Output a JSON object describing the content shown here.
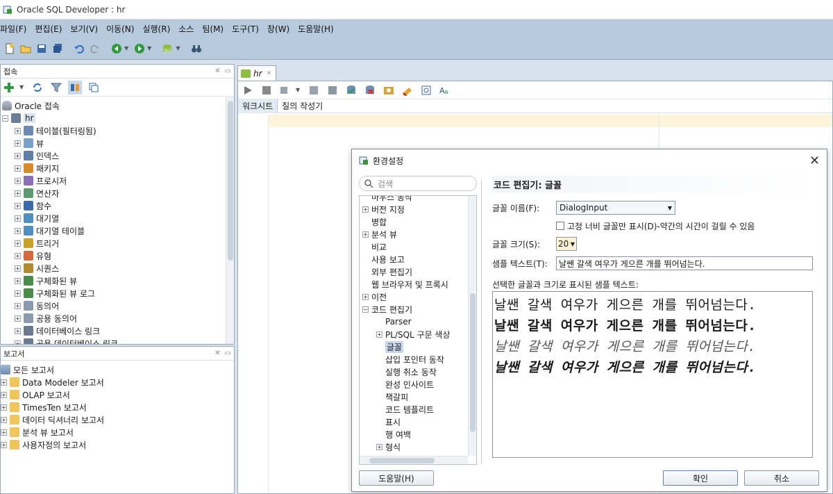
{
  "window": {
    "title": "Oracle SQL Developer : hr"
  },
  "menubar": [
    "파일(F)",
    "편집(E)",
    "보기(V)",
    "이동(N)",
    "실행(R)",
    "소스",
    "팀(M)",
    "도구(T)",
    "창(W)",
    "도움말(H)"
  ],
  "connections": {
    "title": "접속",
    "root": "Oracle 접속",
    "db": "hr",
    "items": [
      "테이블(필터링됨)",
      "뷰",
      "인덱스",
      "패키지",
      "프로시저",
      "연산자",
      "함수",
      "대기열",
      "대기열 테이블",
      "트리거",
      "유형",
      "시퀀스",
      "구체화된 뷰",
      "구체화된 뷰 로그",
      "동의어",
      "공용 동의어",
      "데이터베이스 링크",
      "공용 데이터베이스 링크"
    ]
  },
  "reports": {
    "title": "보고서",
    "items": [
      "모든 보고서",
      "Data Modeler 보고서",
      "OLAP 보고서",
      "TimesTen 보고서",
      "데이터 딕셔너리 보고서",
      "분석 뷰 보고서",
      "사용자정의 보고서"
    ]
  },
  "editor": {
    "tab": "hr",
    "subtabs": [
      "워크시트",
      "질의 작성기"
    ]
  },
  "dialog": {
    "title": "환경설정",
    "search_placeholder": "검색",
    "tree": [
      {
        "label": "마우스 동작",
        "level": 0,
        "exp": ""
      },
      {
        "label": "버전 지정",
        "level": 0,
        "exp": "+"
      },
      {
        "label": "병합",
        "level": 0,
        "exp": ""
      },
      {
        "label": "분석 뷰",
        "level": 0,
        "exp": "+"
      },
      {
        "label": "비교",
        "level": 0,
        "exp": ""
      },
      {
        "label": "사용 보고",
        "level": 0,
        "exp": ""
      },
      {
        "label": "외부 편집기",
        "level": 0,
        "exp": ""
      },
      {
        "label": "웹 브라우저 및 프록시",
        "level": 0,
        "exp": ""
      },
      {
        "label": "이전",
        "level": 0,
        "exp": "+"
      },
      {
        "label": "코드 편집기",
        "level": 0,
        "exp": "-"
      },
      {
        "label": "Parser",
        "level": 1,
        "exp": ""
      },
      {
        "label": "PL/SQL 구문 색상",
        "level": 1,
        "exp": "+"
      },
      {
        "label": "글꼴",
        "level": 1,
        "exp": "",
        "selected": true
      },
      {
        "label": "삽입 포인터 동작",
        "level": 1,
        "exp": ""
      },
      {
        "label": "실행 취소 동작",
        "level": 1,
        "exp": ""
      },
      {
        "label": "완성 인사이트",
        "level": 1,
        "exp": ""
      },
      {
        "label": "책갈피",
        "level": 1,
        "exp": ""
      },
      {
        "label": "코드 템플리트",
        "level": 1,
        "exp": ""
      },
      {
        "label": "표시",
        "level": 1,
        "exp": ""
      },
      {
        "label": "행 여백",
        "level": 1,
        "exp": ""
      },
      {
        "label": "형식",
        "level": 1,
        "exp": "+"
      }
    ],
    "section_title": "코드 편집기: 글꼴",
    "font_name_label": "글꼴 이름(F):",
    "font_name_value": "DialogInput",
    "fixed_width_label": "고정 너비 글꼴만 표시(D)-약간의 시간이 걸릴 수 있음",
    "font_size_label": "글꼴 크기(S):",
    "font_size_value": "20",
    "sample_label": "샘플 텍스트(T):",
    "sample_value": "날쌘 갈색 여우가 게으른 개를 뛰어넘는다.",
    "preview_label": "선택한 글꼴과 크기로 표시된 샘플 텍스트:",
    "preview_lines": [
      "날쌘 갈색 여우가 게으른 개를 뛰어넘는다.",
      "날쌘 갈색 여우가 게으른 개를 뛰어넘는다.",
      "날쌘 갈색 여우가 게으른 개를 뛰어넘는다.",
      "날쌘 갈색 여우가 게으른 개를 뛰어넘는다."
    ],
    "help_button": "도움말(H)",
    "ok_button": "확인",
    "cancel_button": "취소"
  }
}
